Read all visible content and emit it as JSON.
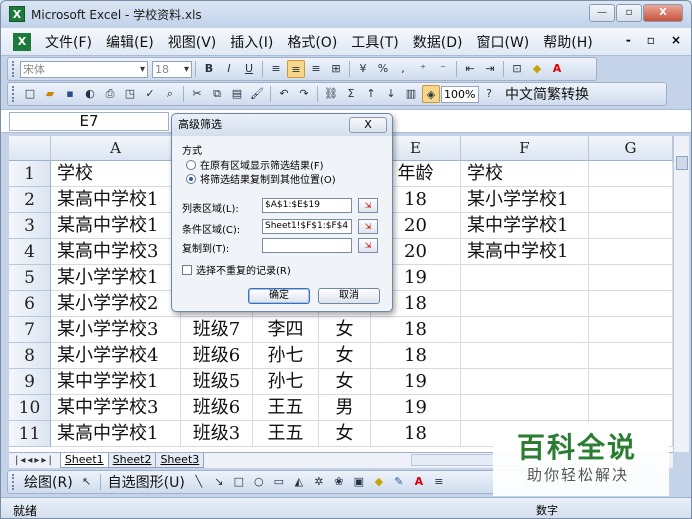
{
  "window": {
    "title": "Microsoft Excel - 学校资料.xls",
    "app_icon": "X",
    "min": "—",
    "restore": "▫",
    "close": "X"
  },
  "menu": {
    "items": [
      "文件(F)",
      "编辑(E)",
      "视图(V)",
      "插入(I)",
      "格式(O)",
      "工具(T)",
      "数据(D)",
      "窗口(W)",
      "帮助(H)"
    ],
    "mdi_min": "-",
    "mdi_restore": "▫",
    "mdi_close": "×"
  },
  "format_toolbar": {
    "font": "宋体",
    "size": "18",
    "bold": "B",
    "italic": "I",
    "underline": "U",
    "percent": "%",
    "comma": ","
  },
  "standard_toolbar": {
    "zoom": "100%",
    "sigma": "Σ",
    "convert": "中文简繁转换"
  },
  "formula_bar": {
    "name_box": "E7"
  },
  "grid": {
    "columns": [
      "A",
      "B",
      "C",
      "D",
      "E",
      "F",
      "G"
    ],
    "rows": [
      {
        "num": "1",
        "cells": [
          "学校",
          "",
          "",
          "",
          "年龄",
          "学校",
          ""
        ]
      },
      {
        "num": "2",
        "cells": [
          "某高中学校1",
          "",
          "",
          "",
          "18",
          "某小学学校1",
          ""
        ]
      },
      {
        "num": "3",
        "cells": [
          "某高中学校1",
          "",
          "",
          "",
          "20",
          "某中学学校1",
          ""
        ]
      },
      {
        "num": "4",
        "cells": [
          "某高中学校3",
          "",
          "",
          "",
          "20",
          "某高中学校1",
          ""
        ]
      },
      {
        "num": "5",
        "cells": [
          "某小学学校1",
          "",
          "",
          "",
          "19",
          "",
          ""
        ]
      },
      {
        "num": "6",
        "cells": [
          "某小学学校2",
          "",
          "",
          "",
          "18",
          "",
          ""
        ]
      },
      {
        "num": "7",
        "cells": [
          "某小学学校3",
          "班级7",
          "李四",
          "女",
          "18",
          "",
          ""
        ]
      },
      {
        "num": "8",
        "cells": [
          "某小学学校4",
          "班级6",
          "孙七",
          "女",
          "18",
          "",
          ""
        ]
      },
      {
        "num": "9",
        "cells": [
          "某中学学校1",
          "班级5",
          "孙七",
          "女",
          "19",
          "",
          ""
        ]
      },
      {
        "num": "10",
        "cells": [
          "某中学学校3",
          "班级6",
          "王五",
          "男",
          "19",
          "",
          ""
        ]
      },
      {
        "num": "11",
        "cells": [
          "某高中学校1",
          "班级3",
          "王五",
          "女",
          "18",
          "",
          ""
        ]
      }
    ]
  },
  "sheets": [
    "Sheet1",
    "Sheet2",
    "Sheet3"
  ],
  "draw_toolbar": {
    "draw": "绘图(R)",
    "autoshape": "自选图形(U)"
  },
  "status": {
    "text": "就绪",
    "num": "数字"
  },
  "watermark": {
    "title": "百科全说",
    "subtitle": "助你轻松解决"
  },
  "dialog": {
    "title": "高级筛选",
    "close": "X",
    "method_label": "方式",
    "radio1": "在原有区域显示筛选结果(F)",
    "radio2": "将筛选结果复制到其他位置(O)",
    "list_label": "列表区域(L):",
    "list_value": "$A$1:$E$19",
    "criteria_label": "条件区域(C):",
    "criteria_value": "Sheet1!$F$1:$F$4",
    "copyto_label": "复制到(T):",
    "copyto_value": "",
    "unique_label": "选择不重复的记录(R)",
    "ok": "确定",
    "cancel": "取消"
  }
}
